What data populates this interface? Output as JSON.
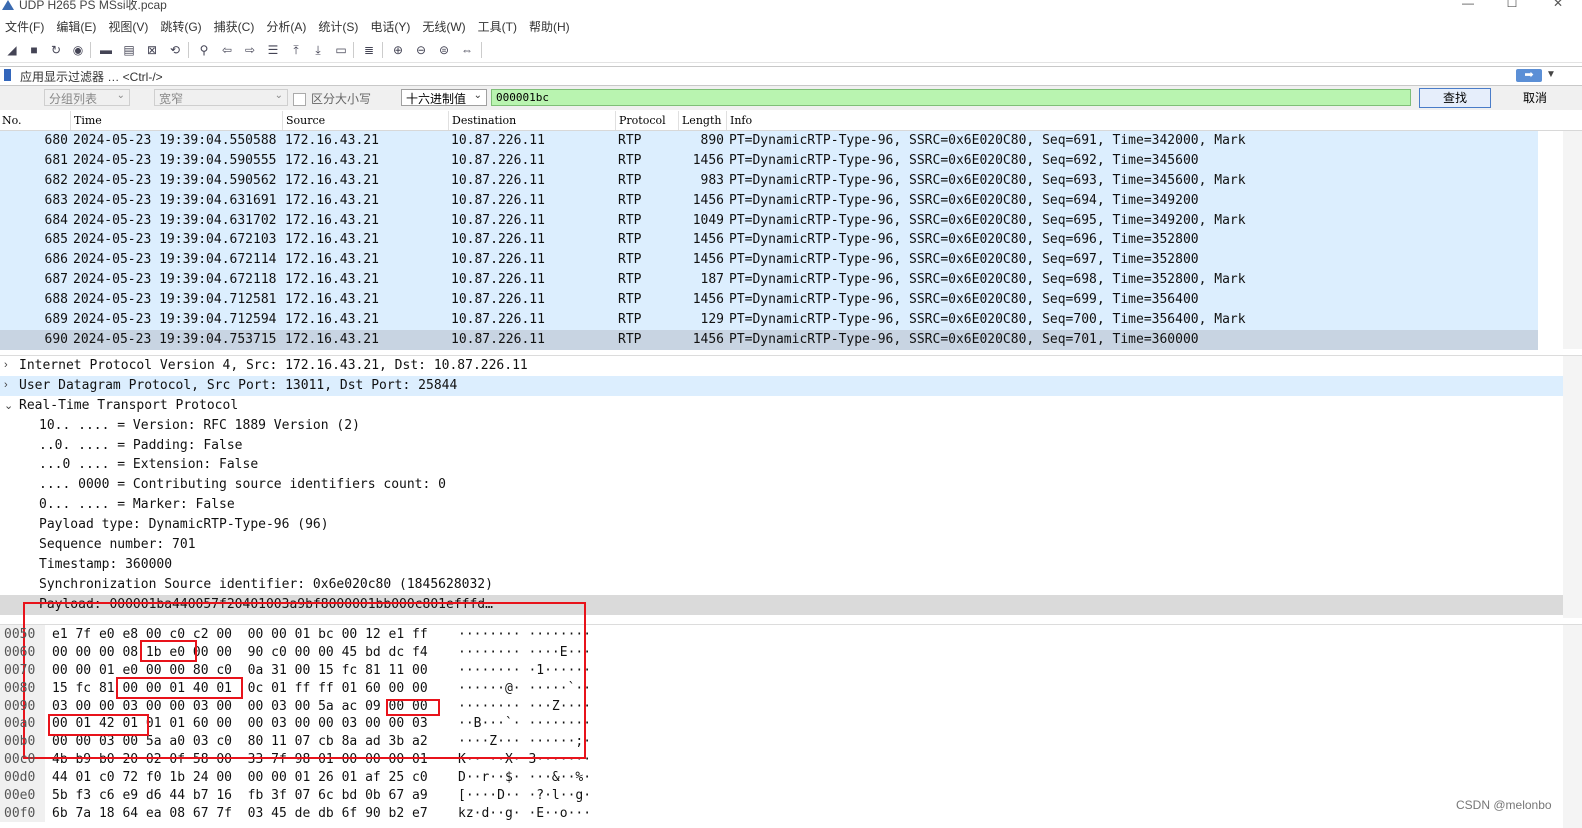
{
  "window": {
    "title": "UDP H265 PS MSsi收.pcap",
    "buttons": [
      "—",
      "☐",
      "✕"
    ]
  },
  "menu": [
    "文件(F)",
    "编辑(E)",
    "视图(V)",
    "跳转(G)",
    "捕获(C)",
    "分析(A)",
    "统计(S)",
    "电话(Y)",
    "无线(W)",
    "工具(T)",
    "帮助(H)"
  ],
  "toolbar": [
    {
      "icon": "shark-fin-start-icon",
      "glyph": "◢"
    },
    {
      "icon": "stop-square-icon",
      "glyph": "■"
    },
    {
      "icon": "restart-capture-icon",
      "glyph": "↻"
    },
    {
      "icon": "capture-options-icon",
      "glyph": "◉"
    },
    {
      "icon": "open-folder-icon",
      "glyph": "▬"
    },
    {
      "icon": "save-file-icon",
      "glyph": "▤"
    },
    {
      "icon": "close-file-icon",
      "glyph": "⊠"
    },
    {
      "icon": "reload-file-icon",
      "glyph": "⟲"
    },
    {
      "icon": "find-packet-icon",
      "glyph": "⚲"
    },
    {
      "icon": "go-back-arrow-icon",
      "glyph": "⇦"
    },
    {
      "icon": "go-forward-arrow-icon",
      "glyph": "⇨"
    },
    {
      "icon": "go-to-packet-icon",
      "glyph": "☰"
    },
    {
      "icon": "first-packet-icon",
      "glyph": "⤒"
    },
    {
      "icon": "last-packet-icon",
      "glyph": "⤓"
    },
    {
      "icon": "auto-scroll-icon",
      "glyph": "▭"
    },
    {
      "icon": "colorize-icon",
      "glyph": "≣"
    },
    {
      "icon": "zoom-in-icon",
      "glyph": "⊕"
    },
    {
      "icon": "zoom-out-icon",
      "glyph": "⊖"
    },
    {
      "icon": "zoom-reset-icon",
      "glyph": "⊜"
    },
    {
      "icon": "resize-columns-icon",
      "glyph": "⇔"
    }
  ],
  "filter": {
    "placeholder": "应用显示过滤器 … <Ctrl-/>",
    "apply_glyph": "➡",
    "dropdown_glyph": "▼"
  },
  "search": {
    "scope": "分组列表",
    "charset": "宽窄",
    "case_label": "区分大小写",
    "type": "十六进制值",
    "value": "000001bc",
    "find_label": "查找",
    "cancel_label": "取消",
    "caret": "⌄"
  },
  "packet_list": {
    "columns": [
      "No.",
      "Time",
      "Source",
      "Destination",
      "Protocol",
      "Length",
      "Info"
    ],
    "rows": [
      {
        "no": "680",
        "time": "2024-05-23 19:39:04.550588",
        "src": "172.16.43.21",
        "dst": "10.87.226.11",
        "proto": "RTP",
        "len": "890",
        "info": "PT=DynamicRTP-Type-96, SSRC=0x6E020C80, Seq=691, Time=342000, Mark"
      },
      {
        "no": "681",
        "time": "2024-05-23 19:39:04.590555",
        "src": "172.16.43.21",
        "dst": "10.87.226.11",
        "proto": "RTP",
        "len": "1456",
        "info": "PT=DynamicRTP-Type-96, SSRC=0x6E020C80, Seq=692, Time=345600"
      },
      {
        "no": "682",
        "time": "2024-05-23 19:39:04.590562",
        "src": "172.16.43.21",
        "dst": "10.87.226.11",
        "proto": "RTP",
        "len": "983",
        "info": "PT=DynamicRTP-Type-96, SSRC=0x6E020C80, Seq=693, Time=345600, Mark"
      },
      {
        "no": "683",
        "time": "2024-05-23 19:39:04.631691",
        "src": "172.16.43.21",
        "dst": "10.87.226.11",
        "proto": "RTP",
        "len": "1456",
        "info": "PT=DynamicRTP-Type-96, SSRC=0x6E020C80, Seq=694, Time=349200"
      },
      {
        "no": "684",
        "time": "2024-05-23 19:39:04.631702",
        "src": "172.16.43.21",
        "dst": "10.87.226.11",
        "proto": "RTP",
        "len": "1049",
        "info": "PT=DynamicRTP-Type-96, SSRC=0x6E020C80, Seq=695, Time=349200, Mark"
      },
      {
        "no": "685",
        "time": "2024-05-23 19:39:04.672103",
        "src": "172.16.43.21",
        "dst": "10.87.226.11",
        "proto": "RTP",
        "len": "1456",
        "info": "PT=DynamicRTP-Type-96, SSRC=0x6E020C80, Seq=696, Time=352800"
      },
      {
        "no": "686",
        "time": "2024-05-23 19:39:04.672114",
        "src": "172.16.43.21",
        "dst": "10.87.226.11",
        "proto": "RTP",
        "len": "1456",
        "info": "PT=DynamicRTP-Type-96, SSRC=0x6E020C80, Seq=697, Time=352800"
      },
      {
        "no": "687",
        "time": "2024-05-23 19:39:04.672118",
        "src": "172.16.43.21",
        "dst": "10.87.226.11",
        "proto": "RTP",
        "len": "187",
        "info": "PT=DynamicRTP-Type-96, SSRC=0x6E020C80, Seq=698, Time=352800, Mark"
      },
      {
        "no": "688",
        "time": "2024-05-23 19:39:04.712581",
        "src": "172.16.43.21",
        "dst": "10.87.226.11",
        "proto": "RTP",
        "len": "1456",
        "info": "PT=DynamicRTP-Type-96, SSRC=0x6E020C80, Seq=699, Time=356400"
      },
      {
        "no": "689",
        "time": "2024-05-23 19:39:04.712594",
        "src": "172.16.43.21",
        "dst": "10.87.226.11",
        "proto": "RTP",
        "len": "129",
        "info": "PT=DynamicRTP-Type-96, SSRC=0x6E020C80, Seq=700, Time=356400, Mark"
      },
      {
        "no": "690",
        "time": "2024-05-23 19:39:04.753715",
        "src": "172.16.43.21",
        "dst": "10.87.226.11",
        "proto": "RTP",
        "len": "1456",
        "info": "PT=DynamicRTP-Type-96, SSRC=0x6E020C80, Seq=701, Time=360000"
      }
    ],
    "selected_no": "690"
  },
  "details": [
    {
      "text": "Internet Protocol Version 4, Src: 172.16.43.21, Dst: 10.87.226.11",
      "level": 0,
      "expander": "›"
    },
    {
      "text": "User Datagram Protocol, Src Port: 13011, Dst Port: 25844",
      "level": 0,
      "expander": "›",
      "highlight": true
    },
    {
      "text": "Real-Time Transport Protocol",
      "level": 0,
      "expander": "⌄"
    },
    {
      "text": "10.. .... = Version: RFC 1889 Version (2)",
      "level": 1
    },
    {
      "text": "..0. .... = Padding: False",
      "level": 1
    },
    {
      "text": "...0 .... = Extension: False",
      "level": 1
    },
    {
      "text": ".... 0000 = Contributing source identifiers count: 0",
      "level": 1
    },
    {
      "text": "0... .... = Marker: False",
      "level": 1
    },
    {
      "text": "Payload type: DynamicRTP-Type-96 (96)",
      "level": 1
    },
    {
      "text": "Sequence number: 701",
      "level": 1
    },
    {
      "text": "Timestamp: 360000",
      "level": 1
    },
    {
      "text": "Synchronization Source identifier: 0x6e020c80 (1845628032)",
      "level": 1
    },
    {
      "text": "Payload: 000001ba440057f20401003a9bf8000001bb000c801efffd…",
      "level": 1,
      "payload": true
    }
  ],
  "bytes": [
    {
      "offset": "0050",
      "hex": "e1 7f e0 e8 00 c0 c2 00  00 00 01 bc 00 12 e1 ff",
      "ascii": "········ ········"
    },
    {
      "offset": "0060",
      "hex": "00 00 00 08 1b e0 00 00  90 c0 00 00 45 bd dc f4",
      "ascii": "········ ····E···"
    },
    {
      "offset": "0070",
      "hex": "00 00 01 e0 00 00 80 c0  0a 31 00 15 fc 81 11 00",
      "ascii": "········ ·1······"
    },
    {
      "offset": "0080",
      "hex": "15 fc 81 00 00 01 40 01  0c 01 ff ff 01 60 00 00",
      "ascii": "······@· ·····`··"
    },
    {
      "offset": "0090",
      "hex": "03 00 00 03 00 00 03 00  00 03 00 5a ac 09 00 00",
      "ascii": "········ ···Z····"
    },
    {
      "offset": "00a0",
      "hex": "00 01 42 01 01 01 60 00  00 03 00 00 03 00 00 03",
      "ascii": "··B···`· ········"
    },
    {
      "offset": "00b0",
      "hex": "00 00 03 00 5a a0 03 c0  80 11 07 cb 8a ad 3b a2",
      "ascii": "····Z··· ······;·"
    },
    {
      "offset": "00c0",
      "hex": "4b b9 b0 20 02 0f 58 00  33 7f 98 01 00 00 00 01",
      "ascii": "K·· ··X· 3·······"
    },
    {
      "offset": "00d0",
      "hex": "44 01 c0 72 f0 1b 24 00  00 00 01 26 01 af 25 c0",
      "ascii": "D··r··$· ···&··%·"
    },
    {
      "offset": "00e0",
      "hex": "5b f3 c6 e9 d6 44 b7 16  fb 3f 07 6c bd 0b 67 a9",
      "ascii": "[····D·· ·?·l··g·"
    },
    {
      "offset": "00f0",
      "hex": "6b 7a 18 64 ea 08 67 7f  03 45 de db 6f 90 b2 e7",
      "ascii": "kz·d··g· ·E··o···"
    }
  ],
  "watermark": "CSDN @melonbo",
  "colors": {
    "row_bg": "#dceefe",
    "row_selected": "#c8d4e2",
    "search_green": "#b9f4b0",
    "annotation_red": "#e8131b"
  }
}
